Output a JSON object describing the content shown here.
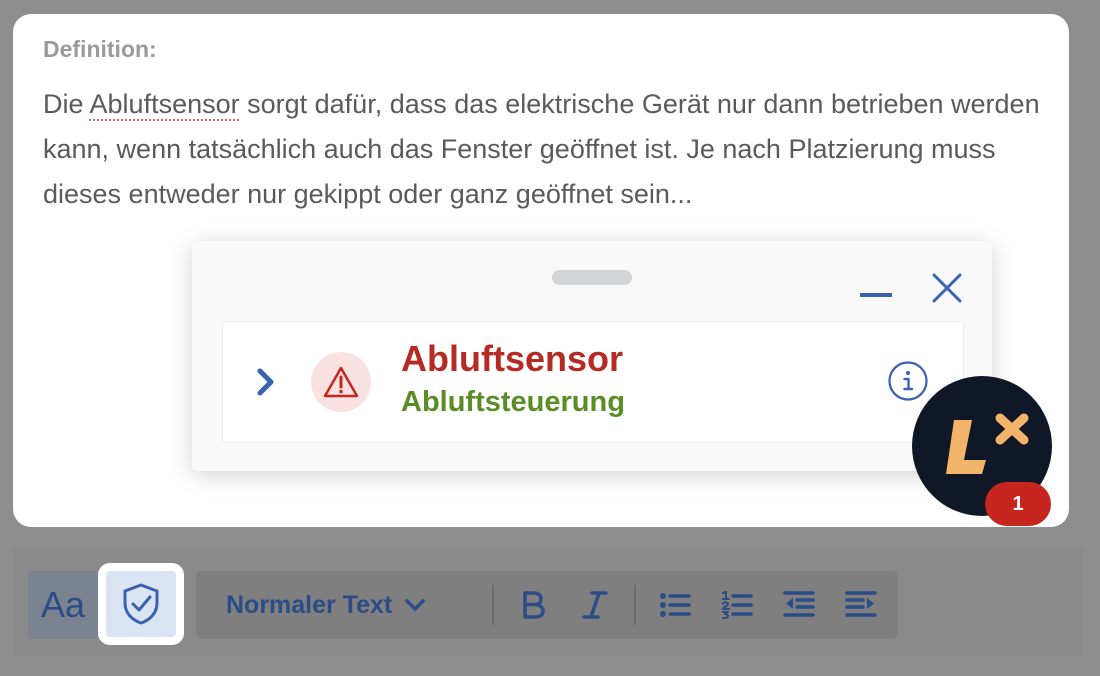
{
  "editor": {
    "definition_label": "Definition:",
    "text_before": "Die ",
    "flagged_word": "Abluftsensor",
    "text_after": " sorgt dafür, dass das elektrische Gerät nur dann betrieben werden kann, wenn tatsächlich auch das Fenster geöffnet ist. Je nach Platzierung muss dieses entweder nur gekippt oder ganz geöffnet sein..."
  },
  "popup": {
    "suggestion": {
      "word": "Abluftsensor",
      "replacement": "Abluftsteuerung"
    }
  },
  "badge": {
    "count": "1"
  },
  "toolbar": {
    "format_button_label": "Aa",
    "text_style": "Normaler Text",
    "icons": [
      "text-format-icon",
      "shield-check-icon",
      "chevron-down-icon",
      "bold-icon",
      "italic-icon",
      "bullet-list-icon",
      "numbered-list-icon",
      "outdent-icon",
      "indent-icon"
    ]
  },
  "colors": {
    "accent": "#3a62b0",
    "error": "#b52a22",
    "suggestion": "#5a8d25",
    "brand_dark": "#101828",
    "brand_orange": "#f2b46a"
  }
}
